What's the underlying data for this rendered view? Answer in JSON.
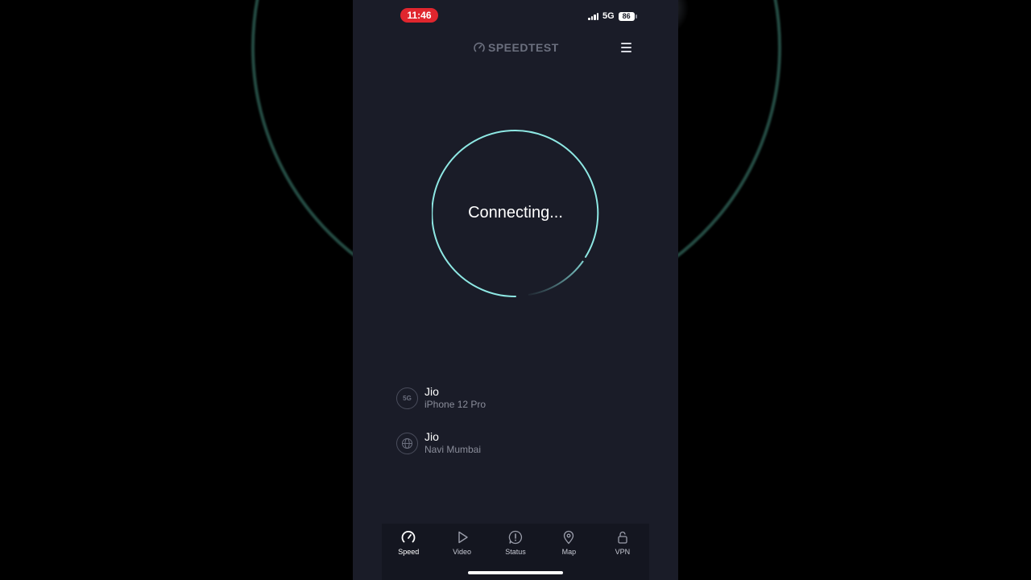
{
  "status_bar": {
    "time": "11:46",
    "network": "5G",
    "battery": "86"
  },
  "header": {
    "brand": "SPEEDTEST"
  },
  "gauge": {
    "label": "Connecting..."
  },
  "connections": [
    {
      "badge": "5G",
      "title": "Jio",
      "subtitle": "iPhone 12 Pro",
      "icon": "5g-icon"
    },
    {
      "badge": "",
      "title": "Jio",
      "subtitle": "Navi Mumbai",
      "icon": "globe-icon"
    }
  ],
  "tabs": [
    {
      "label": "Speed",
      "icon": "speedometer-icon",
      "active": true
    },
    {
      "label": "Video",
      "icon": "play-icon",
      "active": false
    },
    {
      "label": "Status",
      "icon": "alert-icon",
      "active": false
    },
    {
      "label": "Map",
      "icon": "map-pin-icon",
      "active": false
    },
    {
      "label": "VPN",
      "icon": "lock-icon",
      "active": false
    }
  ],
  "colors": {
    "accent": "#8ee8e4",
    "background": "#1a1c28",
    "time_badge": "#e0262e"
  }
}
